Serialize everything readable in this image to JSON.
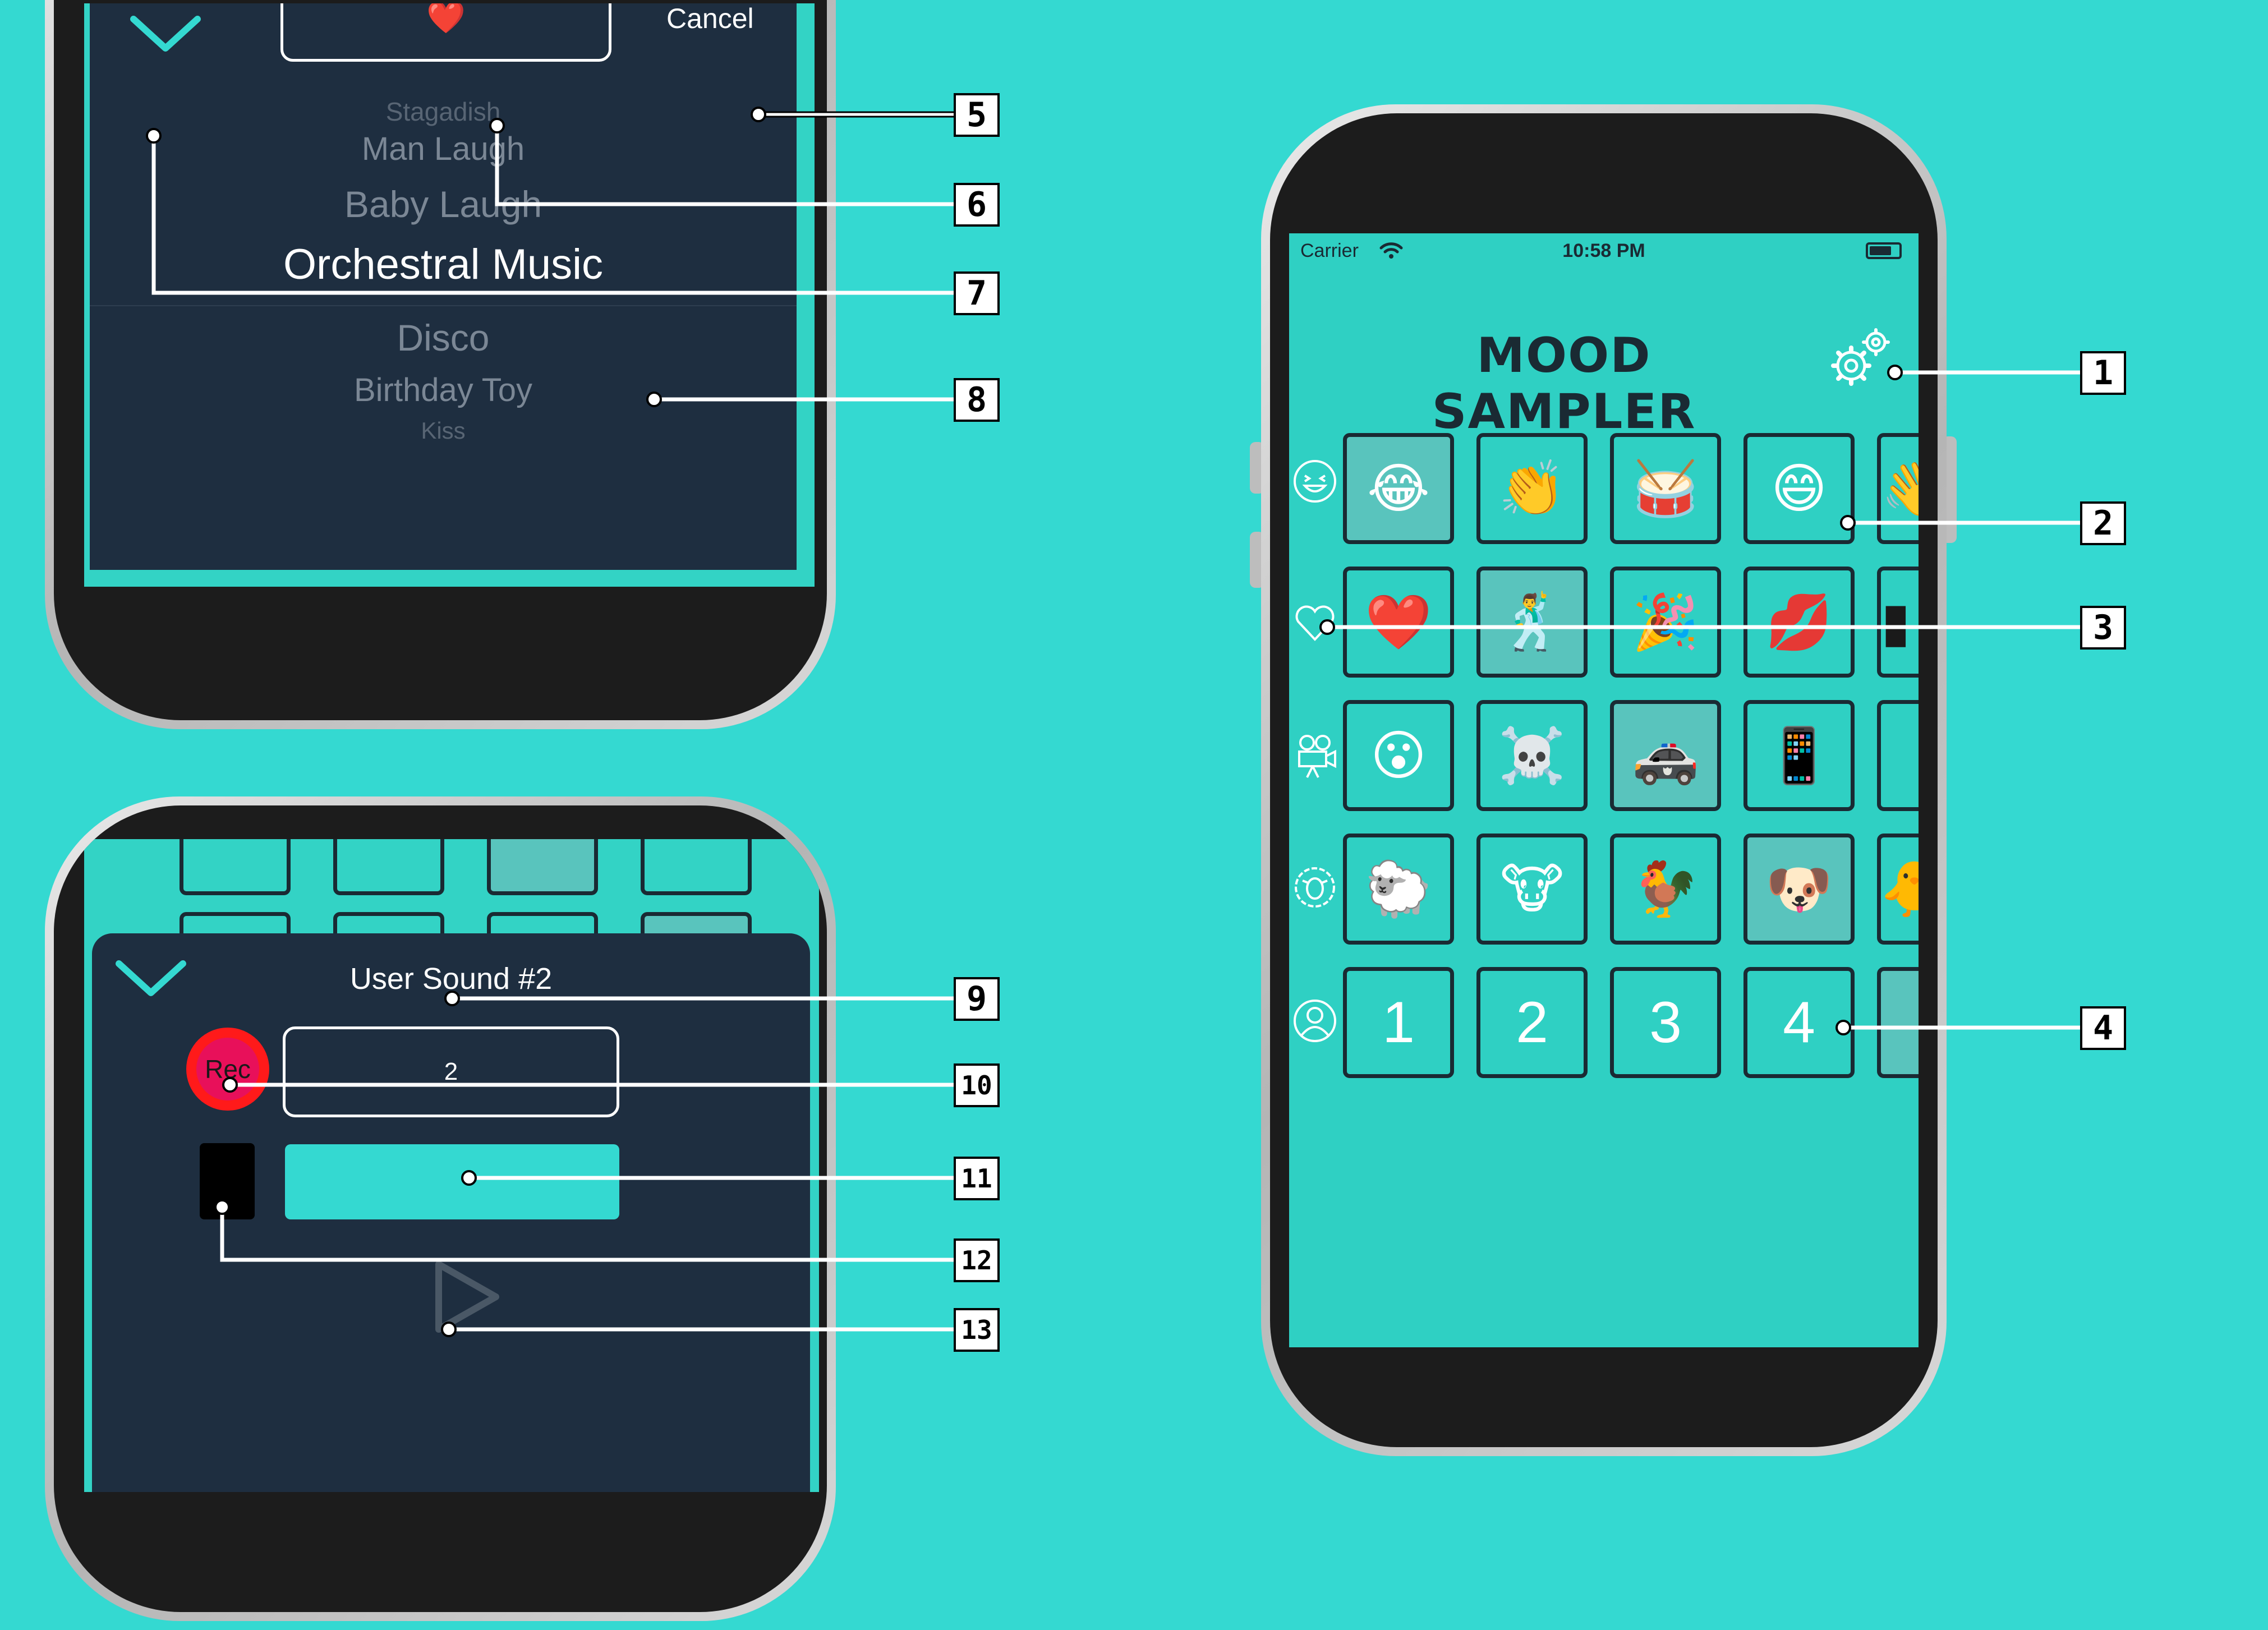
{
  "colors": {
    "background": "#34d9d1",
    "panel": "#1e2e40",
    "accent": "#34d9d1",
    "record": "#ff1a1a"
  },
  "picker_screen": {
    "selected_emoji": "❤️",
    "cancel_label": "Cancel",
    "chevron_icon": "chevron-down-icon",
    "items": [
      "Stagadish",
      "Man Laugh",
      "Baby Laugh",
      "Orchestral Music",
      "Disco",
      "Birthday Toy",
      "Kiss"
    ],
    "selected_item": "Orchestral Music"
  },
  "record_screen": {
    "title": "User Sound #2",
    "record_label": "Rec",
    "name_value": "2",
    "chevron_icon": "chevron-down-icon",
    "play_icon": "play-icon"
  },
  "main_screen": {
    "status_bar": {
      "carrier": "Carrier",
      "time": "10:58 PM"
    },
    "app_title": "MOOD SAMPLER",
    "settings_icon": "gears-icon",
    "categories": [
      {
        "icon": "laughing-face-icon",
        "tiles": [
          "😂",
          "👏",
          "🥁",
          "😄",
          "👋"
        ]
      },
      {
        "icon": "heart-icon",
        "tiles": [
          "❤️",
          "🕺",
          "🎉",
          "💋",
          "▮"
        ]
      },
      {
        "icon": "movie-camera-icon",
        "tiles": [
          "😮",
          "☠️",
          "🚓",
          "📱",
          ""
        ]
      },
      {
        "icon": "sheep-icon",
        "tiles": [
          "🐑",
          "🐮",
          "🐓",
          "🐶",
          "🐥"
        ]
      },
      {
        "icon": "user-icon",
        "tiles": [
          "1",
          "2",
          "3",
          "4",
          ""
        ]
      }
    ]
  },
  "callouts": [
    "1",
    "2",
    "3",
    "4",
    "5",
    "6",
    "7",
    "8",
    "9",
    "10",
    "11",
    "12",
    "13"
  ]
}
